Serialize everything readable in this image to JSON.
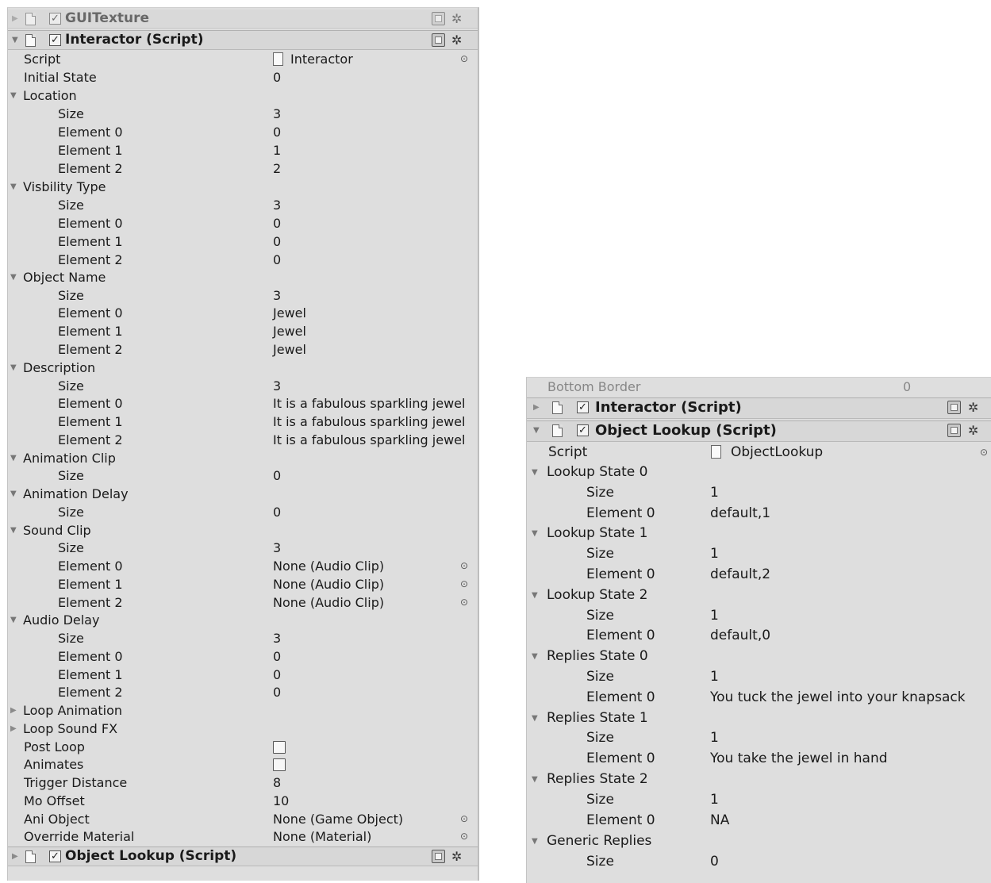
{
  "left": {
    "partial_component": "GUITexture",
    "interactor": {
      "title": "Interactor (Script)",
      "script_label": "Script",
      "script_value": "Interactor",
      "initial_state_label": "Initial State",
      "initial_state_value": "0",
      "location": {
        "label": "Location",
        "size_label": "Size",
        "size": "3",
        "elements": [
          {
            "label": "Element 0",
            "value": "0"
          },
          {
            "label": "Element 1",
            "value": "1"
          },
          {
            "label": "Element 2",
            "value": "2"
          }
        ]
      },
      "visibility": {
        "label": "Visbility Type",
        "size_label": "Size",
        "size": "3",
        "elements": [
          {
            "label": "Element 0",
            "value": "0"
          },
          {
            "label": "Element 1",
            "value": "0"
          },
          {
            "label": "Element 2",
            "value": "0"
          }
        ]
      },
      "object_name": {
        "label": "Object Name",
        "size_label": "Size",
        "size": "3",
        "elements": [
          {
            "label": "Element 0",
            "value": "Jewel"
          },
          {
            "label": "Element 1",
            "value": "Jewel"
          },
          {
            "label": "Element 2",
            "value": "Jewel"
          }
        ]
      },
      "description": {
        "label": "Description",
        "size_label": "Size",
        "size": "3",
        "elements": [
          {
            "label": "Element 0",
            "value": "It is a fabulous sparkling jewel"
          },
          {
            "label": "Element 1",
            "value": "It is a fabulous sparkling jewel"
          },
          {
            "label": "Element 2",
            "value": "It is a fabulous sparkling jewel"
          }
        ]
      },
      "animation_clip": {
        "label": "Animation Clip",
        "size_label": "Size",
        "size": "0"
      },
      "animation_delay": {
        "label": "Animation Delay",
        "size_label": "Size",
        "size": "0"
      },
      "sound_clip": {
        "label": "Sound Clip",
        "size_label": "Size",
        "size": "3",
        "elements": [
          {
            "label": "Element 0",
            "value": "None (Audio Clip)"
          },
          {
            "label": "Element 1",
            "value": "None (Audio Clip)"
          },
          {
            "label": "Element 2",
            "value": "None (Audio Clip)"
          }
        ]
      },
      "audio_delay": {
        "label": "Audio Delay",
        "size_label": "Size",
        "size": "3",
        "elements": [
          {
            "label": "Element 0",
            "value": "0"
          },
          {
            "label": "Element 1",
            "value": "0"
          },
          {
            "label": "Element 2",
            "value": "0"
          }
        ]
      },
      "loop_animation": "Loop Animation",
      "loop_sound_fx": "Loop Sound FX",
      "post_loop": "Post Loop",
      "animates": "Animates",
      "trigger_distance_label": "Trigger Distance",
      "trigger_distance": "8",
      "mo_offset_label": "Mo Offset",
      "mo_offset": "10",
      "ani_object_label": "Ani Object",
      "ani_object": "None (Game Object)",
      "override_material_label": "Override Material",
      "override_material": "None (Material)"
    },
    "object_lookup_title": "Object Lookup (Script)"
  },
  "right": {
    "partial_field": "Bottom Border",
    "partial_value": "0",
    "interactor_title": "Interactor (Script)",
    "object_lookup": {
      "title": "Object Lookup (Script)",
      "script_label": "Script",
      "script_value": "ObjectLookup",
      "groups": [
        {
          "label": "Lookup State 0",
          "size_label": "Size",
          "size": "1",
          "element_label": "Element 0",
          "element_value": "default,1"
        },
        {
          "label": "Lookup State 1",
          "size_label": "Size",
          "size": "1",
          "element_label": "Element 0",
          "element_value": "default,2"
        },
        {
          "label": "Lookup State 2",
          "size_label": "Size",
          "size": "1",
          "element_label": "Element 0",
          "element_value": "default,0"
        },
        {
          "label": "Replies State 0",
          "size_label": "Size",
          "size": "1",
          "element_label": "Element 0",
          "element_value": "You tuck the jewel into your knapsack"
        },
        {
          "label": "Replies State 1",
          "size_label": "Size",
          "size": "1",
          "element_label": "Element 0",
          "element_value": "You take the jewel in hand"
        },
        {
          "label": "Replies State 2",
          "size_label": "Size",
          "size": "1",
          "element_label": "Element 0",
          "element_value": "NA"
        }
      ],
      "generic_replies": {
        "label": "Generic Replies",
        "size_label": "Size",
        "size": "0"
      }
    }
  },
  "icons": {
    "fold_open": "▼",
    "fold_closed": "▶",
    "check": "✓",
    "gear": "✲",
    "object_picker": "⊙"
  }
}
